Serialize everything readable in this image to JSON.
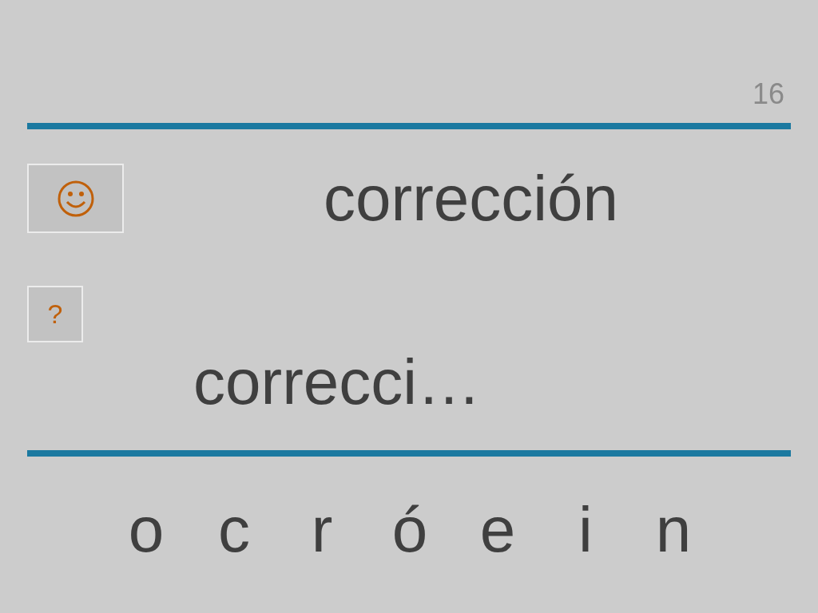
{
  "page_number": "16",
  "word": "corrección",
  "help_button": {
    "label": "?"
  },
  "answer": "correcci…",
  "letters": [
    "o",
    "c",
    "r",
    "ó",
    "e",
    "i",
    "n"
  ]
}
